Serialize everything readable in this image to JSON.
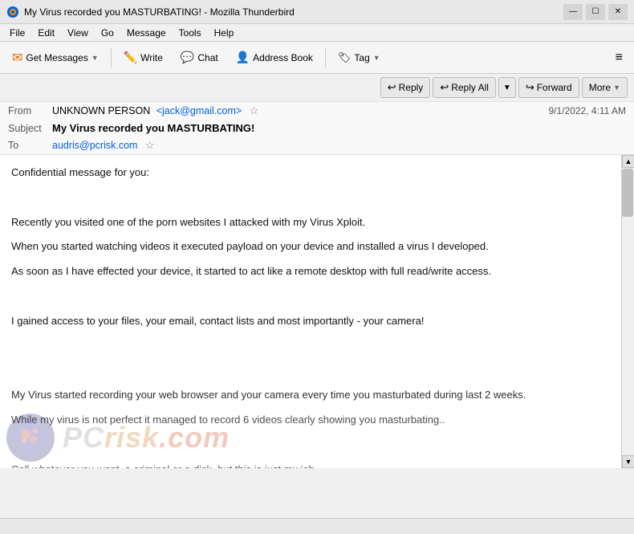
{
  "window": {
    "title": "My Virus recorded you MASTURBATING! - Mozilla Thunderbird",
    "icon": "thunderbird"
  },
  "titlebar": {
    "minimize": "—",
    "maximize": "☐",
    "close": "✕"
  },
  "menubar": {
    "items": [
      "File",
      "Edit",
      "View",
      "Go",
      "Message",
      "Tools",
      "Help"
    ]
  },
  "toolbar": {
    "get_messages": "Get Messages",
    "write": "Write",
    "chat": "Chat",
    "address_book": "Address Book",
    "tag": "Tag",
    "hamburger": "≡"
  },
  "actions": {
    "reply": "Reply",
    "reply_all": "Reply All",
    "forward": "Forward",
    "more": "More"
  },
  "email": {
    "from_label": "From",
    "from_name": "UNKNOWN PERSON",
    "from_email": "<jack@gmail.com>",
    "subject_label": "Subject",
    "subject": "My Virus recorded you MASTURBATING!",
    "to_label": "To",
    "to_email": "audris@pcrisk.com",
    "date": "9/1/2022, 4:11 AM",
    "body": [
      "Confidential message for you:",
      "",
      "Recently you visited one of the porn websites I attacked with my Virus Xploit.",
      "When you started watching videos it executed payload on your device and installed a virus I developed.",
      "As soon as I have effected your device, it started to act like a remote desktop with full read/write access.",
      "",
      "I gained access to your files, your email, contact lists and most importantly - your camera!",
      "",
      "",
      "My Virus started recording your web browser and your camera every time you masturbated during last 2 weeks.",
      "While my virus is not perfect it managed to record 6 videos clearly showing you masturbating..",
      "",
      "Call whatever you want, a criminal or a dick, but this is just my job."
    ]
  },
  "watermark": {
    "text1": "PC",
    "text2": "risk",
    "text3": ".com"
  },
  "statusbar": {
    "text": ""
  }
}
